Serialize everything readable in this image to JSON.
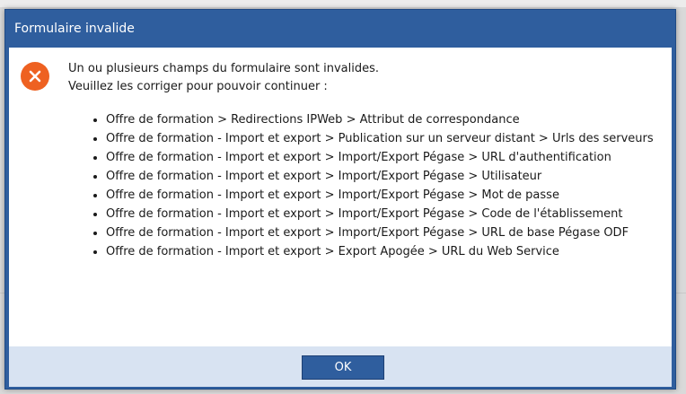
{
  "dialog": {
    "title": "Formulaire invalide",
    "icon": "error-x-icon",
    "message_line1": "Un ou plusieurs champs du formulaire sont invalides.",
    "message_line2": "Veuillez les corriger pour pouvoir continuer :",
    "errors": [
      "Offre de formation > Redirections IPWeb > Attribut de correspondance",
      "Offre de formation - Import et export > Publication sur un serveur distant > Urls des serveurs",
      "Offre de formation - Import et export > Import/Export Pégase > URL d'authentification",
      "Offre de formation - Import et export > Import/Export Pégase > Utilisateur",
      "Offre de formation - Import et export > Import/Export Pégase > Mot de passe",
      "Offre de formation - Import et export > Import/Export Pégase > Code de l'établissement",
      "Offre de formation - Import et export > Import/Export Pégase > URL de base Pégase ODF",
      "Offre de formation - Import et export > Export Apogée > URL du Web Service"
    ],
    "ok_label": "OK"
  },
  "colors": {
    "titlebar": "#2f5e9e",
    "error_icon": "#ee6121",
    "footer": "#d8e3f2"
  }
}
